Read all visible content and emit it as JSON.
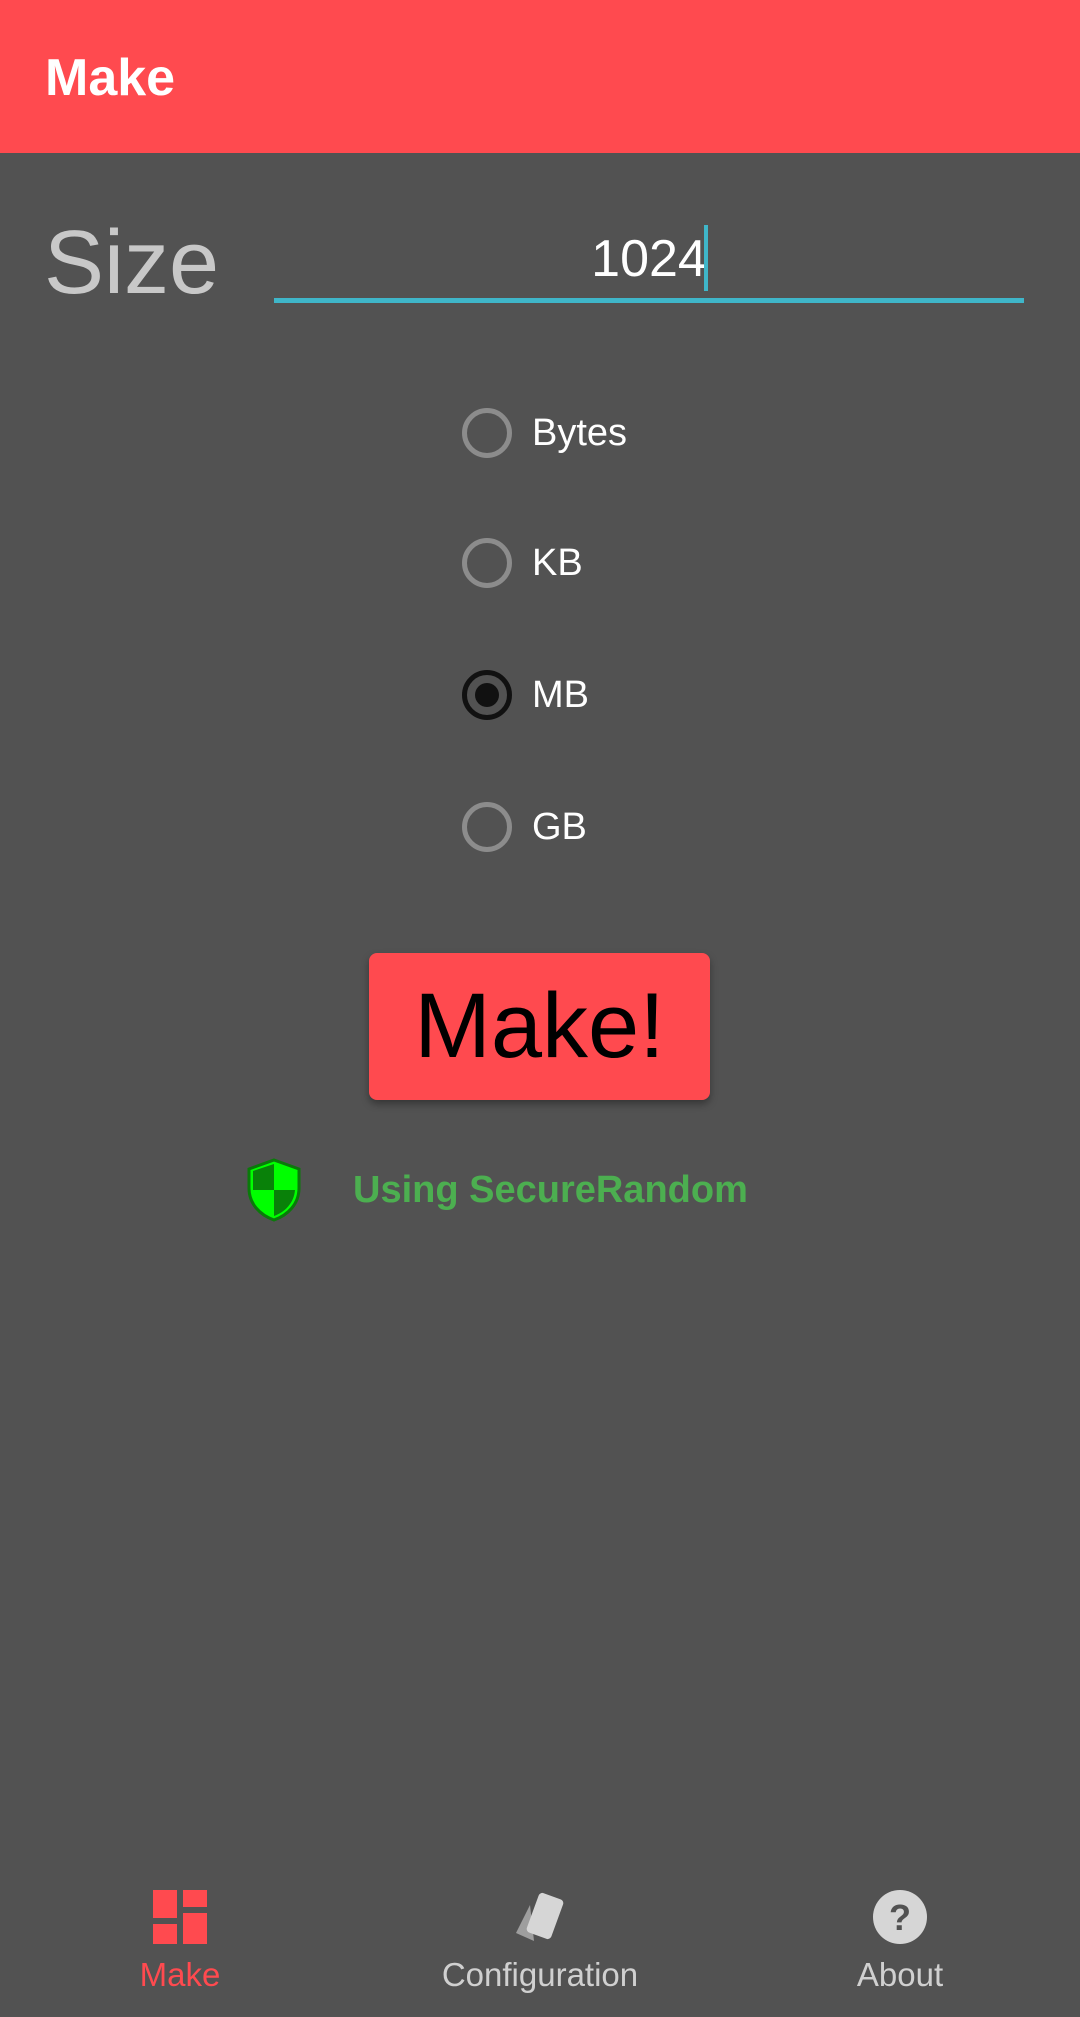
{
  "appbar": {
    "title": "Make"
  },
  "form": {
    "size_label": "Size",
    "size_value": "1024",
    "units": [
      {
        "label": "Bytes",
        "checked": false
      },
      {
        "label": "KB",
        "checked": false
      },
      {
        "label": "MB",
        "checked": true
      },
      {
        "label": "GB",
        "checked": false
      }
    ],
    "make_button_label": "Make!",
    "secure_status": "Using SecureRandom"
  },
  "bottom_nav": {
    "items": [
      {
        "label": "Make",
        "icon": "dashboard-icon",
        "active": true
      },
      {
        "label": "Configuration",
        "icon": "cards-icon",
        "active": false
      },
      {
        "label": "About",
        "icon": "help-icon",
        "active": false
      }
    ]
  },
  "colors": {
    "accent": "#FF4A4F",
    "background": "#525252",
    "input_underline": "#3fb6c9",
    "secure_text": "#4caf50",
    "shield": "#00ff00"
  }
}
